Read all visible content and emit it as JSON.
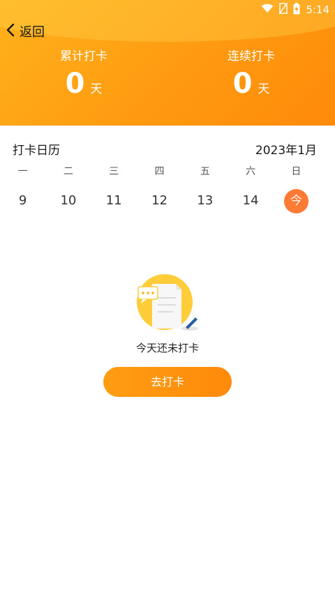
{
  "status_bar": {
    "time": "5:14",
    "icons": [
      "wifi-icon",
      "no-sim-icon",
      "battery-charging-icon"
    ]
  },
  "header": {
    "back_label": "返回",
    "total": {
      "label": "累计打卡",
      "value": "0",
      "unit": "天"
    },
    "streak": {
      "label": "连续打卡",
      "value": "0",
      "unit": "天"
    }
  },
  "calendar": {
    "title": "打卡日历",
    "month": "2023年1月",
    "weekdays": [
      "一",
      "二",
      "三",
      "四",
      "五",
      "六",
      "日"
    ],
    "dates": [
      "9",
      "10",
      "11",
      "12",
      "13",
      "14"
    ],
    "today_label": "今"
  },
  "empty_state": {
    "message": "今天还未打卡"
  },
  "action": {
    "checkin_label": "去打卡"
  },
  "colors": {
    "header": "#ff9a10",
    "accent": "#ff7a34",
    "button": "#ff8a0a"
  }
}
